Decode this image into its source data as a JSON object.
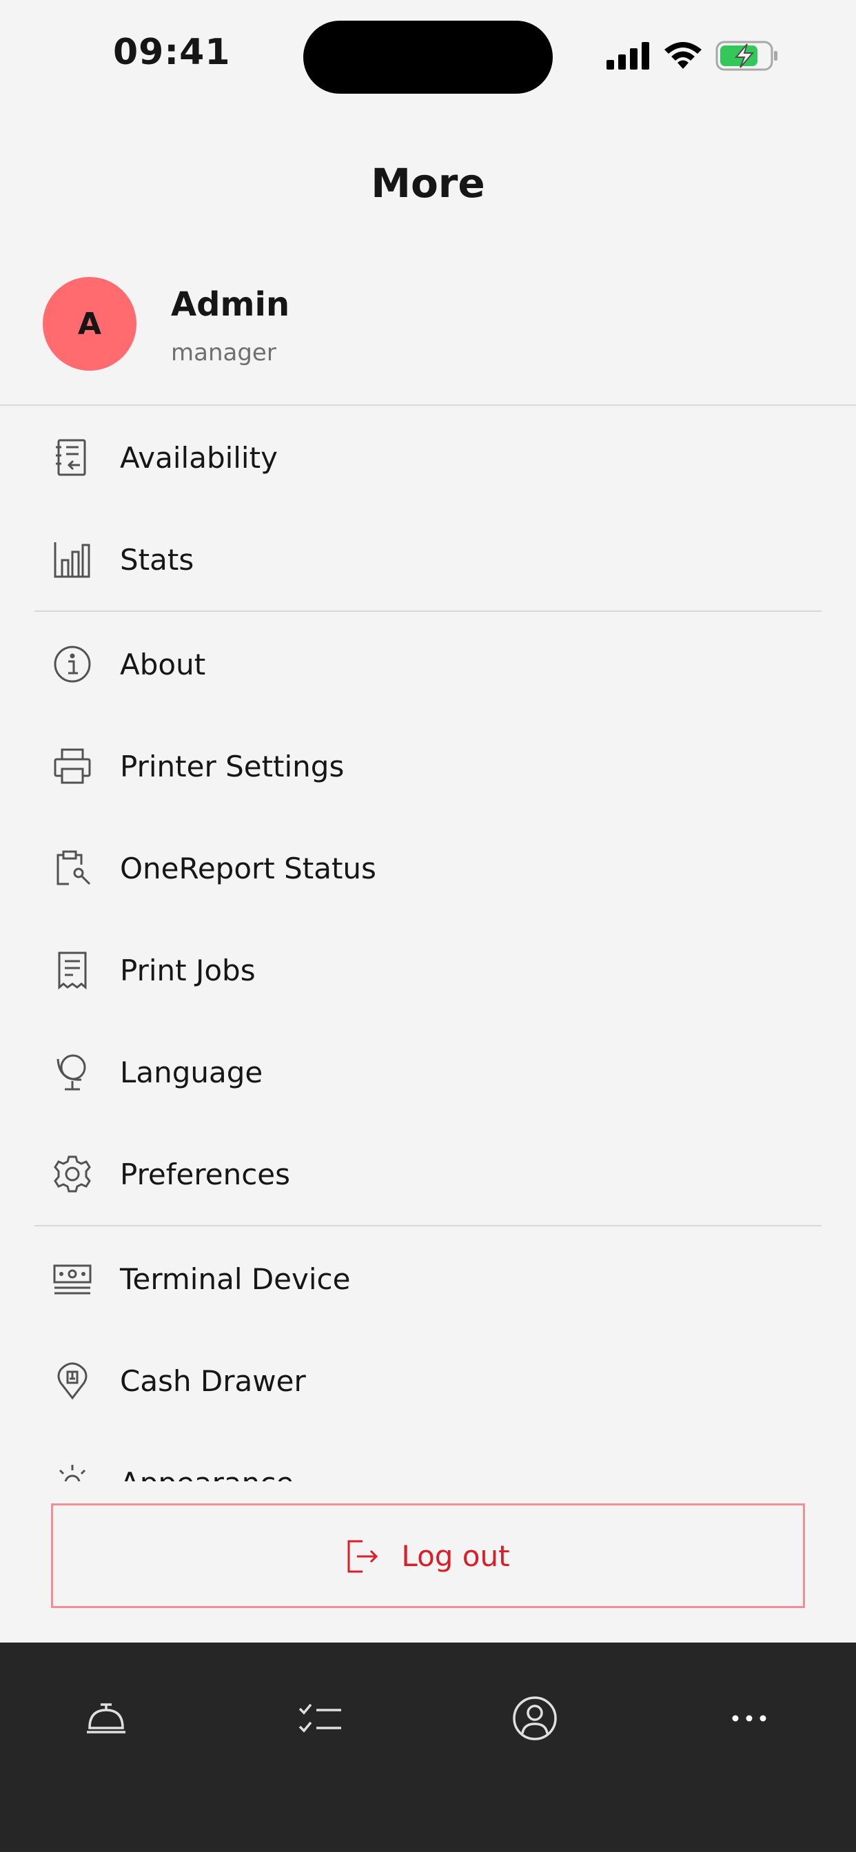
{
  "status_bar": {
    "time": "09:41"
  },
  "header": {
    "title": "More"
  },
  "profile": {
    "initial": "A",
    "name": "Admin",
    "role": "manager",
    "avatar_color": "#ff6b6f"
  },
  "menu": {
    "items": [
      {
        "label": "Availability",
        "icon": "availability-list-icon"
      },
      {
        "label": "Stats",
        "icon": "bar-chart-icon"
      },
      {
        "label": "About",
        "icon": "info-icon"
      },
      {
        "label": "Printer Settings",
        "icon": "printer-icon"
      },
      {
        "label": "OneReport Status",
        "icon": "clipboard-wrench-icon"
      },
      {
        "label": "Print Jobs",
        "icon": "receipt-icon"
      },
      {
        "label": "Language",
        "icon": "globe-icon"
      },
      {
        "label": "Preferences",
        "icon": "gear-icon"
      },
      {
        "label": "Terminal Device",
        "icon": "terminal-device-icon"
      },
      {
        "label": "Cash Drawer",
        "icon": "location-pin-icon"
      },
      {
        "label": "Appearance",
        "icon": "sun-icon"
      }
    ]
  },
  "logout": {
    "label": "Log out",
    "color": "#da1e28"
  },
  "tab_bar": {
    "tabs": [
      {
        "icon": "service-bell-icon"
      },
      {
        "icon": "checklist-icon"
      },
      {
        "icon": "user-profile-icon"
      },
      {
        "icon": "more-dots-icon"
      }
    ]
  }
}
